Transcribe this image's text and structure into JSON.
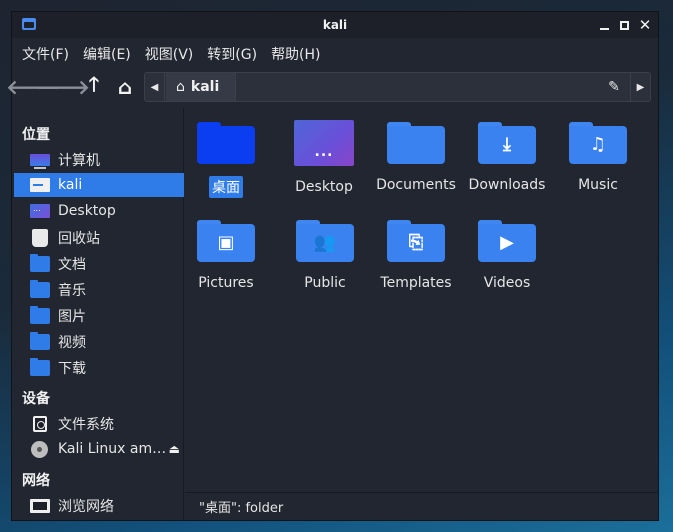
{
  "window": {
    "title": "kali"
  },
  "menubar": [
    "文件(F)",
    "编辑(E)",
    "视图(V)",
    "转到(G)",
    "帮助(H)"
  ],
  "toolbar": {
    "back_icon": "arrow-left-icon",
    "forward_icon": "arrow-right-icon",
    "up_icon": "arrow-up-icon",
    "home_icon": "home-icon"
  },
  "pathbar": {
    "current": "kali",
    "edit_icon": "pencil-icon"
  },
  "sidebar": {
    "places_header": "位置",
    "places": [
      {
        "label": "计算机",
        "icon": "computer-icon"
      },
      {
        "label": "kali",
        "icon": "home-folder-icon",
        "selected": true
      },
      {
        "label": "Desktop",
        "icon": "desktop-icon"
      },
      {
        "label": "回收站",
        "icon": "trash-icon"
      },
      {
        "label": "文档",
        "icon": "folder-icon"
      },
      {
        "label": "音乐",
        "icon": "folder-icon"
      },
      {
        "label": "图片",
        "icon": "folder-icon"
      },
      {
        "label": "视频",
        "icon": "folder-icon"
      },
      {
        "label": "下载",
        "icon": "folder-icon"
      }
    ],
    "devices_header": "设备",
    "devices": [
      {
        "label": "文件系统",
        "icon": "drive-icon"
      },
      {
        "label": "Kali Linux am…",
        "icon": "disc-icon",
        "eject": "eject-icon"
      }
    ],
    "network_header": "网络",
    "network": [
      {
        "label": "浏览网络",
        "icon": "network-icon"
      }
    ]
  },
  "files": [
    {
      "label": "桌面",
      "icon": "folder-icon",
      "selected": true
    },
    {
      "label": "Desktop",
      "icon": "desktop-thumbnail-icon"
    },
    {
      "label": "Documents",
      "icon": "folder-icon"
    },
    {
      "label": "Downloads",
      "icon": "folder-download-icon"
    },
    {
      "label": "Music",
      "icon": "folder-music-icon"
    },
    {
      "label": "Pictures",
      "icon": "folder-pictures-icon"
    },
    {
      "label": "Public",
      "icon": "folder-public-icon"
    },
    {
      "label": "Templates",
      "icon": "folder-templates-icon"
    },
    {
      "label": "Videos",
      "icon": "folder-videos-icon"
    }
  ],
  "statusbar": {
    "text": "\"桌面\": folder"
  },
  "colors": {
    "accent": "#2f7be8",
    "folder": "#3a82f0",
    "window_bg": "#222630"
  }
}
